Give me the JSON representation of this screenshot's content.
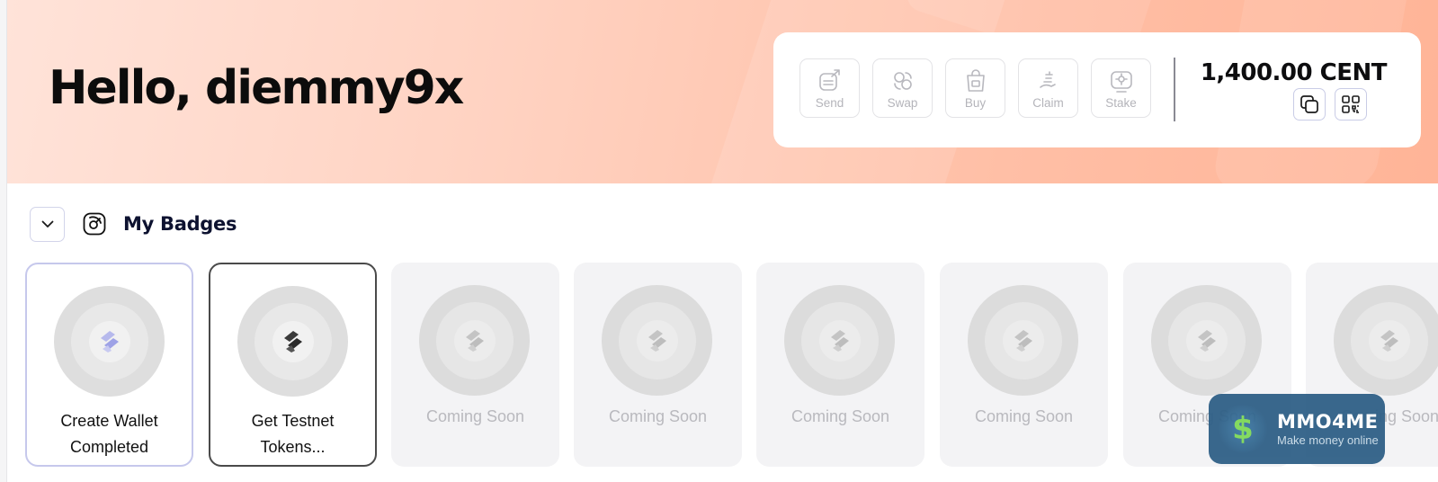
{
  "header": {
    "greeting": "Hello, diemmy9x"
  },
  "wallet": {
    "actions": [
      {
        "label": "Send",
        "icon": "send-icon"
      },
      {
        "label": "Swap",
        "icon": "swap-icon"
      },
      {
        "label": "Buy",
        "icon": "buy-icon"
      },
      {
        "label": "Claim",
        "icon": "claim-icon"
      },
      {
        "label": "Stake",
        "icon": "stake-icon"
      }
    ],
    "balance": "1,400.00 CENT",
    "copy_icon": "copy-icon",
    "qr_icon": "qr-code-icon"
  },
  "badges": {
    "title": "My Badges",
    "collapse_icon": "chevron-down-icon",
    "section_icon": "badge-icon",
    "items": [
      {
        "label_line1": "Create Wallet",
        "label_line2": "Completed",
        "state": "completed"
      },
      {
        "label_line1": "Get Testnet",
        "label_line2": "Tokens...",
        "state": "active"
      },
      {
        "label_line1": "Coming Soon",
        "label_line2": "",
        "state": "locked"
      },
      {
        "label_line1": "Coming Soon",
        "label_line2": "",
        "state": "locked"
      },
      {
        "label_line1": "Coming Soon",
        "label_line2": "",
        "state": "locked"
      },
      {
        "label_line1": "Coming Soon",
        "label_line2": "",
        "state": "locked"
      },
      {
        "label_line1": "Coming Soon",
        "label_line2": "",
        "state": "locked"
      },
      {
        "label_line1": "Coming Soon",
        "label_line2": "",
        "state": "locked"
      }
    ]
  },
  "watermark": {
    "symbol": "$",
    "title": "MMO4ME",
    "subtitle": "Make money online"
  },
  "colors": {
    "hero_start": "#ffe3d9",
    "hero_end": "#ffb497",
    "badge_completed_border": "#c6c8ec",
    "badge_active_border": "#4a4a4a",
    "muted_text": "#b4b4ba"
  }
}
